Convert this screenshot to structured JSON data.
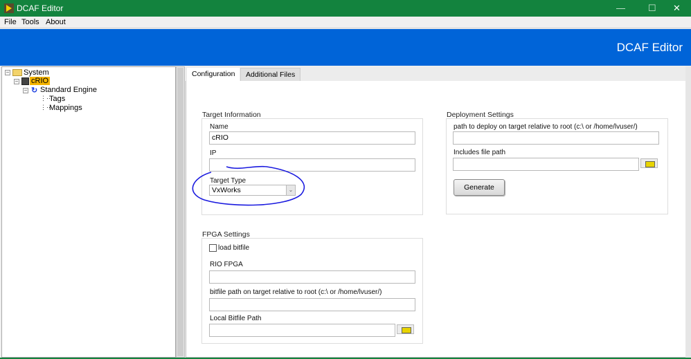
{
  "window": {
    "title": "DCAF Editor",
    "controls": [
      "minimize",
      "maximize",
      "close"
    ]
  },
  "menu": [
    "File",
    "Tools",
    "About"
  ],
  "banner": {
    "title": "DCAF Editor"
  },
  "tree": {
    "items": [
      {
        "label": "System",
        "icon": "folder-icon",
        "level": 0
      },
      {
        "label": "cRIO",
        "icon": "crio-icon",
        "level": 1,
        "selected": true
      },
      {
        "label": "Standard Engine",
        "icon": "engine-icon",
        "level": 2
      },
      {
        "label": "Tags",
        "icon": "list-icon",
        "level": 3
      },
      {
        "label": "Mappings",
        "icon": "list-icon",
        "level": 3
      }
    ]
  },
  "tabs": [
    {
      "label": "Configuration",
      "active": true
    },
    {
      "label": "Additional Files",
      "active": false
    }
  ],
  "target": {
    "group": "Target Information",
    "name_label": "Name",
    "name_value": "cRIO",
    "ip_label": "IP",
    "ip_value": "",
    "type_label": "Target Type",
    "type_value": "VxWorks"
  },
  "deploy": {
    "group": "Deployment Settings",
    "path_label": "path to deploy on target relative to root (c:\\ or /home/lvuser/)",
    "path_value": "",
    "includes_label": "Includes file path",
    "includes_value": "",
    "generate": "Generate"
  },
  "fpga": {
    "group": "FPGA Settings",
    "load_label": "load bitfile",
    "load_checked": false,
    "rio_label": "RIO FPGA",
    "rio_value": "",
    "bitpath_label": "bitfile path on target relative to root (c:\\ or /home/lvuser/)",
    "bitpath_value": "",
    "local_label": "Local Bitfile Path",
    "local_value": ""
  },
  "colors": {
    "titlebar": "#13833e",
    "banner": "#0064d8",
    "selection": "#f5b400",
    "annotation": "#1a1adf"
  }
}
